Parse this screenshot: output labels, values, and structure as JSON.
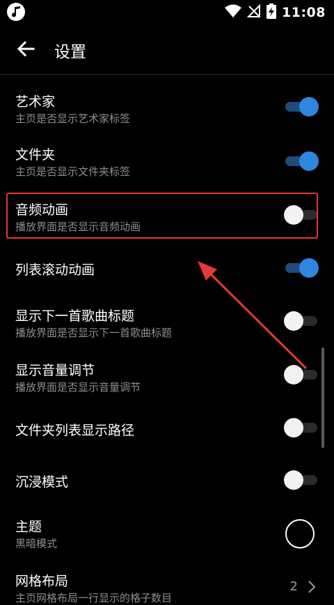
{
  "status_bar": {
    "time": "11:08"
  },
  "toolbar": {
    "title": "设置"
  },
  "settings": [
    {
      "label": "艺术家",
      "subtitle": "主页是否显示艺术家标签",
      "state": "on"
    },
    {
      "label": "文件夹",
      "subtitle": "主页是否显示文件夹标签",
      "state": "on"
    },
    {
      "label": "音频动画",
      "subtitle": "播放界面是否显示音频动画",
      "state": "off"
    },
    {
      "label": "列表滚动动画",
      "state": "on"
    },
    {
      "label": "显示下一首歌曲标题",
      "subtitle": "播放界面是否显示下一首歌曲标题",
      "state": "off"
    },
    {
      "label": "显示音量调节",
      "subtitle": "播放界面是否显示音量调节",
      "state": "off"
    },
    {
      "label": "文件夹列表显示路径",
      "state": "off"
    },
    {
      "label": "沉浸模式",
      "state": "off"
    },
    {
      "label": "主题",
      "subtitle": "黑暗模式",
      "swatch_color": "#000000"
    },
    {
      "label": "网格布局",
      "subtitle": "主页网格布局一行显示的格子数目",
      "value": "2"
    }
  ],
  "colors": {
    "accent": "#2e86de",
    "highlight": "#e53935"
  },
  "icons": [
    "music-note-icon",
    "wifi-icon",
    "no-signal-icon",
    "battery-charging-icon",
    "back-arrow-icon",
    "chevron-right-icon"
  ]
}
